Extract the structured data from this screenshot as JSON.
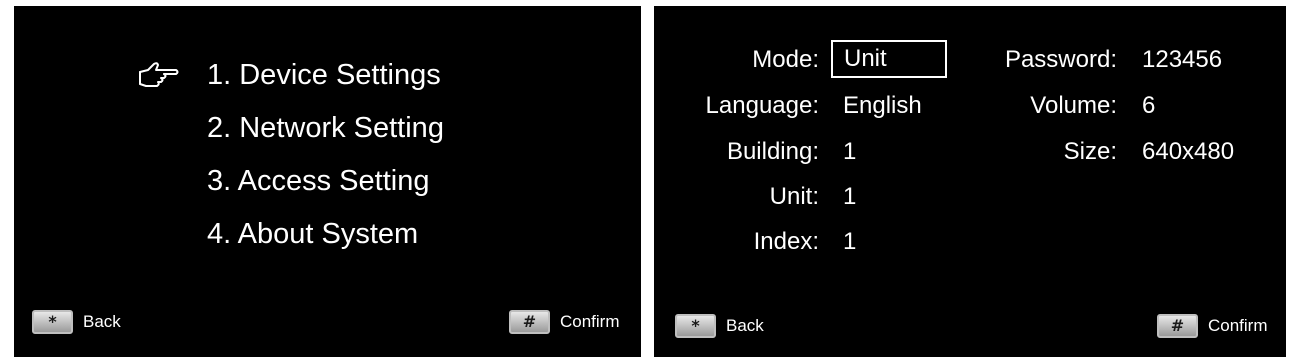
{
  "left_screen": {
    "selected_icon": "pointing-hand-icon",
    "menu_items": [
      {
        "label": "1. Device Settings"
      },
      {
        "label": "2. Network Setting"
      },
      {
        "label": "3. Access Setting"
      },
      {
        "label": "4. About System"
      }
    ],
    "footer": {
      "back_key": "*",
      "back_label": "Back",
      "confirm_key": "#",
      "confirm_label": "Confirm"
    }
  },
  "right_screen": {
    "fields": {
      "mode": {
        "label": "Mode:",
        "value": "Unit"
      },
      "language": {
        "label": "Language:",
        "value": "English"
      },
      "building": {
        "label": "Building:",
        "value": "1"
      },
      "unit": {
        "label": "Unit:",
        "value": "1"
      },
      "index": {
        "label": "Index:",
        "value": "1"
      },
      "password": {
        "label": "Password:",
        "value": "123456"
      },
      "volume": {
        "label": "Volume:",
        "value": "6"
      },
      "size": {
        "label": "Size:",
        "value": "640x480"
      }
    },
    "footer": {
      "back_key": "*",
      "back_label": "Back",
      "confirm_key": "#",
      "confirm_label": "Confirm"
    }
  },
  "colors": {
    "screen_background": "#000000",
    "text": "#ffffff",
    "key_cap": "#d0d0d0"
  }
}
